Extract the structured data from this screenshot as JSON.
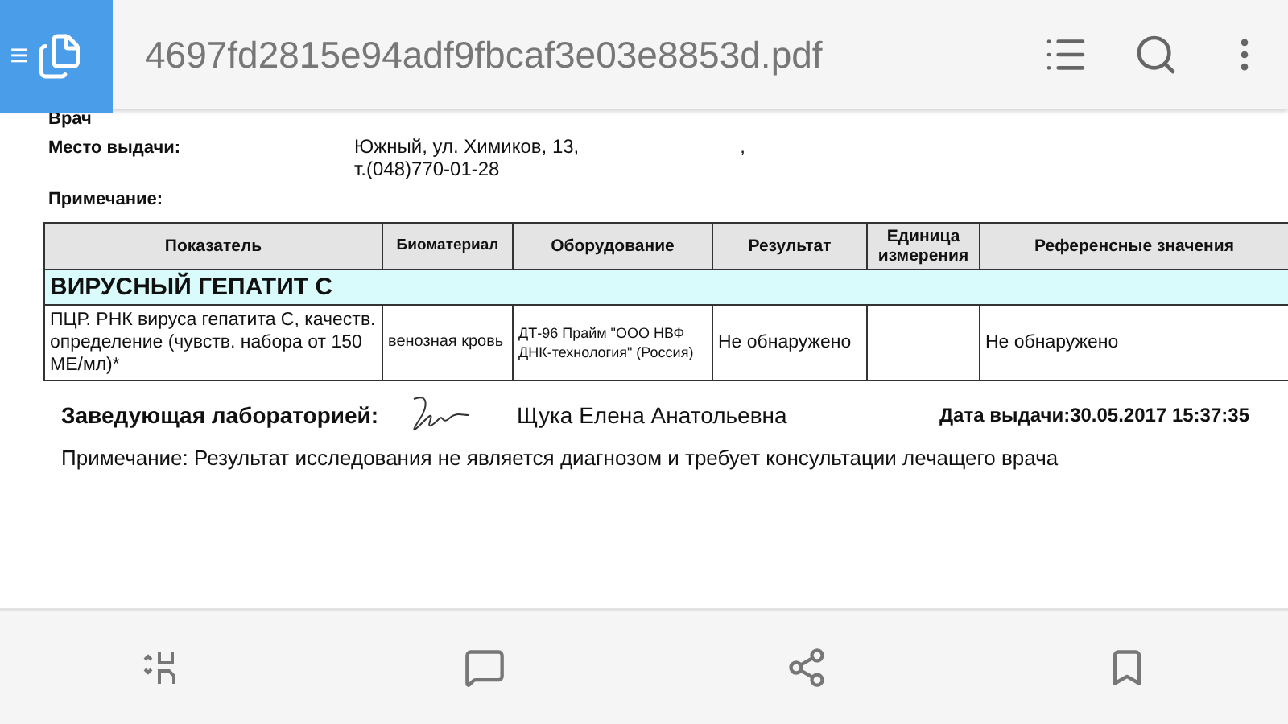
{
  "app_bar": {
    "menu_glyph": "≡",
    "file_name": "4697fd2815e94adf9fbcaf3e03e8853d.pdf"
  },
  "document": {
    "top_label": "Врач",
    "fields": [
      {
        "label": "Место выдачи:",
        "value_lines": [
          "Южный, ул. Химиков, 13,                              ,",
          "т.(048)770-01-28"
        ]
      },
      {
        "label": "Примечание:"
      }
    ],
    "table": {
      "columns": [
        "Показатель",
        "Биоматериал",
        "Оборудование",
        "Результат",
        "Единица измерения",
        "Референсные значения"
      ],
      "section": "ВИРУСНЫЙ ГЕПАТИТ С",
      "rows": [
        [
          "ПЦР. РНК вируса гепатита С, качеств. определение (чувств. набора от 150 МЕ/мл)*",
          "венозная кровь",
          "ДТ-96 Прайм \"ООО НВФ ДНК-технология\" (Россия)",
          "Не обнаружено",
          "",
          "Не обнаружено"
        ]
      ]
    },
    "head_label": "Заведующая лабораторией:",
    "head_name": "Щука Елена Анатольевна",
    "issue_date": "Дата выдачи:30.05.2017 15:37:35",
    "note": "Примечание: Результат исследования не является диагнозом и требует консультации лечащего врача"
  }
}
